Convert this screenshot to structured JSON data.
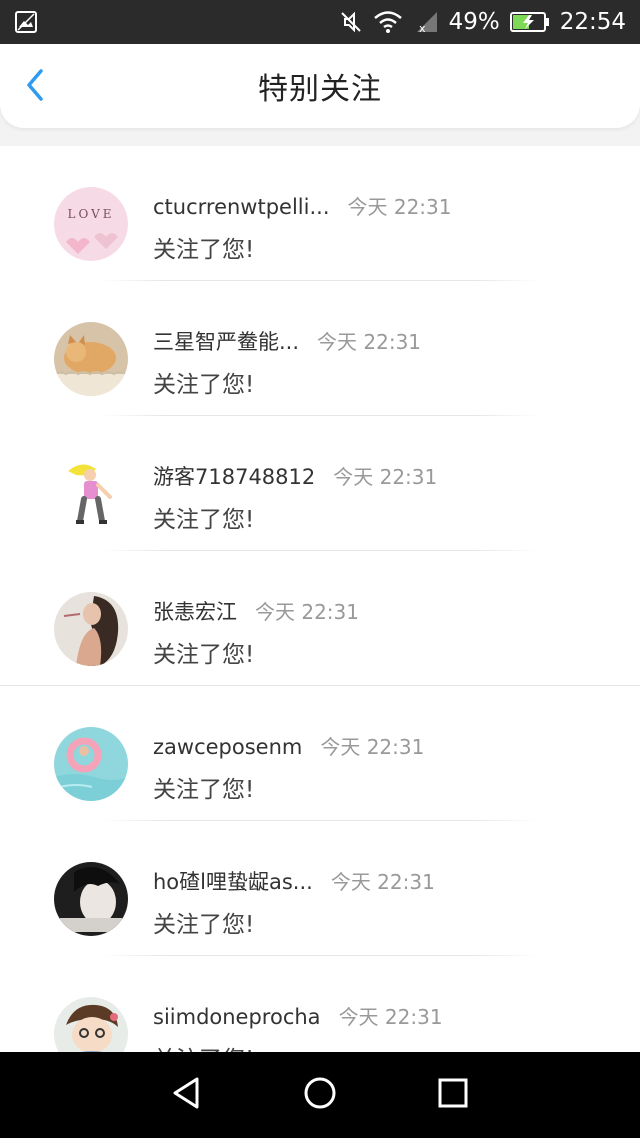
{
  "status_bar": {
    "battery_percent": "49%",
    "time": "22:54"
  },
  "header": {
    "title": "特别关注",
    "back_icon": "chevron-left-icon",
    "accent_color": "#2e9bf0"
  },
  "notifications": [
    {
      "name": "ctucrrenwtpelli...",
      "time": "今天 22:31",
      "message": "关注了您!",
      "avatar": "love-hearts-avatar"
    },
    {
      "name": "三星智严鲞能...",
      "time": "今天 22:31",
      "message": "关注了您!",
      "avatar": "cat-avatar"
    },
    {
      "name": "游客718748812",
      "time": "今天 22:31",
      "message": "关注了您!",
      "avatar": "cartoon-girl-avatar"
    },
    {
      "name": "张恚宏江",
      "time": "今天 22:31",
      "message": "关注了您!",
      "avatar": "woman-photo-avatar"
    },
    {
      "name": "zawceposenm",
      "time": "今天 22:31",
      "message": "关注了您!",
      "avatar": "pool-float-avatar"
    },
    {
      "name": "ho碴l哩蛰龊as...",
      "time": "今天 22:31",
      "message": "关注了您!",
      "avatar": "dark-photo-avatar"
    },
    {
      "name": "siimdoneprocha",
      "time": "今天 22:31",
      "message": "关注了您!",
      "avatar": "cartoon-boy-avatar"
    }
  ]
}
